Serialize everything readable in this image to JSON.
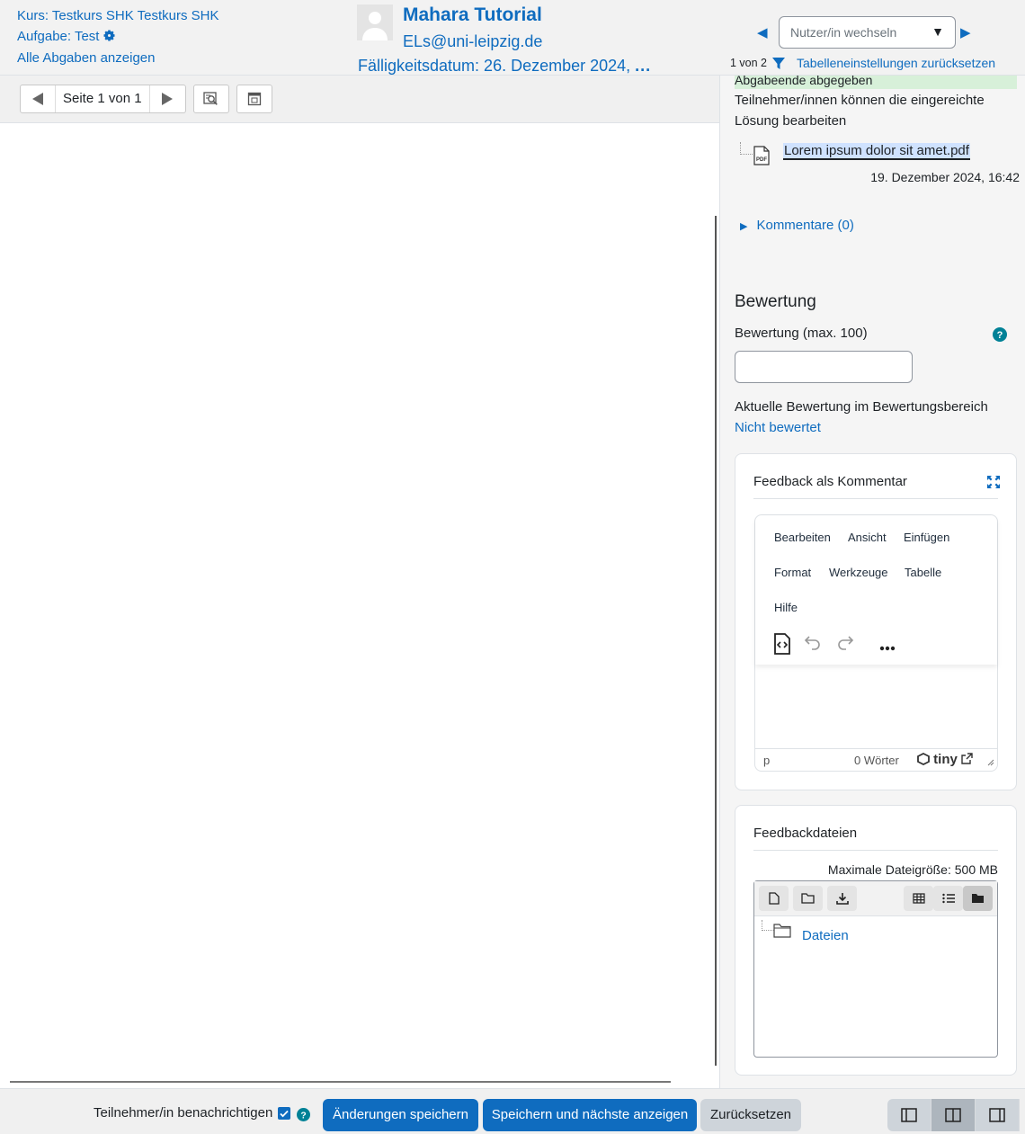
{
  "header": {
    "course_link": "Kurs: Testkurs SHK Testkurs SHK",
    "assignment_link": "Aufgabe: Test",
    "view_all_link": "Alle Abgaben anzeigen",
    "user_name": "Mahara Tutorial",
    "user_email": "ELs@uni-leipzig.de",
    "due_date": "Fälligkeitsdatum: 26. Dezember 2024,",
    "due_date_more": "...",
    "user_select_placeholder": "Nutzer/in wechseln",
    "user_count": "1 von 2",
    "reset_table_link": "Tabelleneinstellungen zurücksetzen"
  },
  "toolbar": {
    "page_indicator": "Seite 1 von 1"
  },
  "submission": {
    "status": "Abgabeende abgegeben",
    "edit_note": "Teilnehmer/innen können die eingereichte Lösung bearbeiten",
    "file_name": "Lorem ipsum dolor sit amet.pdf",
    "file_date": "19. Dezember 2024, 16:42",
    "comments_link": "Kommentare (0)"
  },
  "grading": {
    "heading": "Bewertung",
    "grade_label": "Bewertung (max. 100)",
    "grade_value": "",
    "current_grade_label": "Aktuelle Bewertung im Bewertungsbereich",
    "current_grade_value": "Nicht bewertet"
  },
  "feedback_comment": {
    "title": "Feedback als Kommentar",
    "menu": [
      "Bearbeiten",
      "Ansicht",
      "Einfügen",
      "Format",
      "Werkzeuge",
      "Tabelle",
      "Hilfe"
    ],
    "status_path": "p",
    "word_count": "0 Wörter",
    "brand": "tiny"
  },
  "feedback_files": {
    "title": "Feedbackdateien",
    "max_size": "Maximale Dateigröße: 500 MB",
    "folder_name": "Dateien"
  },
  "footer": {
    "notify_label": "Teilnehmer/in benachrichtigen",
    "notify_checked": true,
    "save_button": "Änderungen speichern",
    "save_next_button": "Speichern und nächste anzeigen",
    "reset_button": "Zurücksetzen"
  },
  "colors": {
    "accent": "#0f6cbf",
    "status_green": "#d7f0d9",
    "file_highlight": "#cfe2ff"
  }
}
